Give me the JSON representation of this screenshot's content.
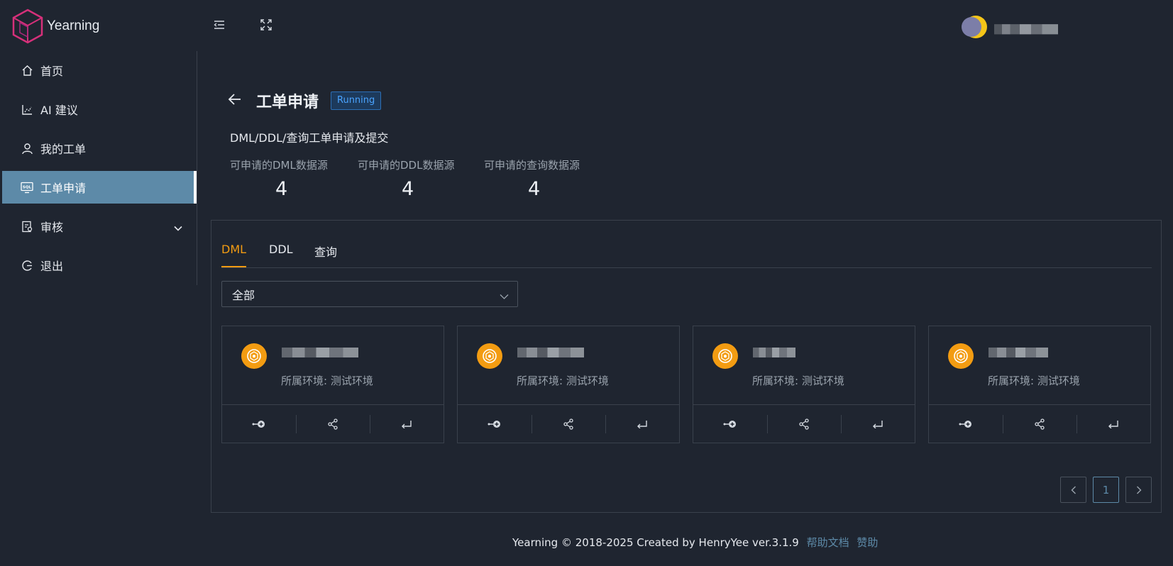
{
  "app": {
    "name": "Yearning"
  },
  "sidebar": {
    "items": [
      {
        "label": "首页",
        "icon": "home-icon"
      },
      {
        "label": "AI 建议",
        "icon": "chart-icon"
      },
      {
        "label": "我的工单",
        "icon": "user-icon"
      },
      {
        "label": "工单申请",
        "icon": "sql-monitor-icon",
        "active": true
      },
      {
        "label": "审核",
        "icon": "audit-icon",
        "expandable": true
      },
      {
        "label": "退出",
        "icon": "logout-icon"
      }
    ]
  },
  "page": {
    "title": "工单申请",
    "status": "Running",
    "subtitle": "DML/DDL/查询工单申请及提交",
    "stats": [
      {
        "label": "可申请的DML数据源",
        "value": "4"
      },
      {
        "label": "可申请的DDL数据源",
        "value": "4"
      },
      {
        "label": "可申请的查询数据源",
        "value": "4"
      }
    ]
  },
  "tabs": [
    {
      "label": "DML",
      "active": true
    },
    {
      "label": "DDL"
    },
    {
      "label": "查询"
    }
  ],
  "filter": {
    "selected": "全部"
  },
  "cards": [
    {
      "env": "所属环境: 测试环境"
    },
    {
      "env": "所属环境: 测试环境"
    },
    {
      "env": "所属环境: 测试环境"
    },
    {
      "env": "所属环境: 测试环境"
    }
  ],
  "pagination": {
    "current": "1"
  },
  "footer": {
    "text": "Yearning © 2018-2025 Created by HenryYee ver.3.1.9",
    "links": [
      "帮助文档",
      "赞助"
    ]
  },
  "colors": {
    "accent": "#f39c12",
    "active_nav": "#5d8aa8",
    "running_badge": "#4aa3ff",
    "background": "#1f2530"
  }
}
